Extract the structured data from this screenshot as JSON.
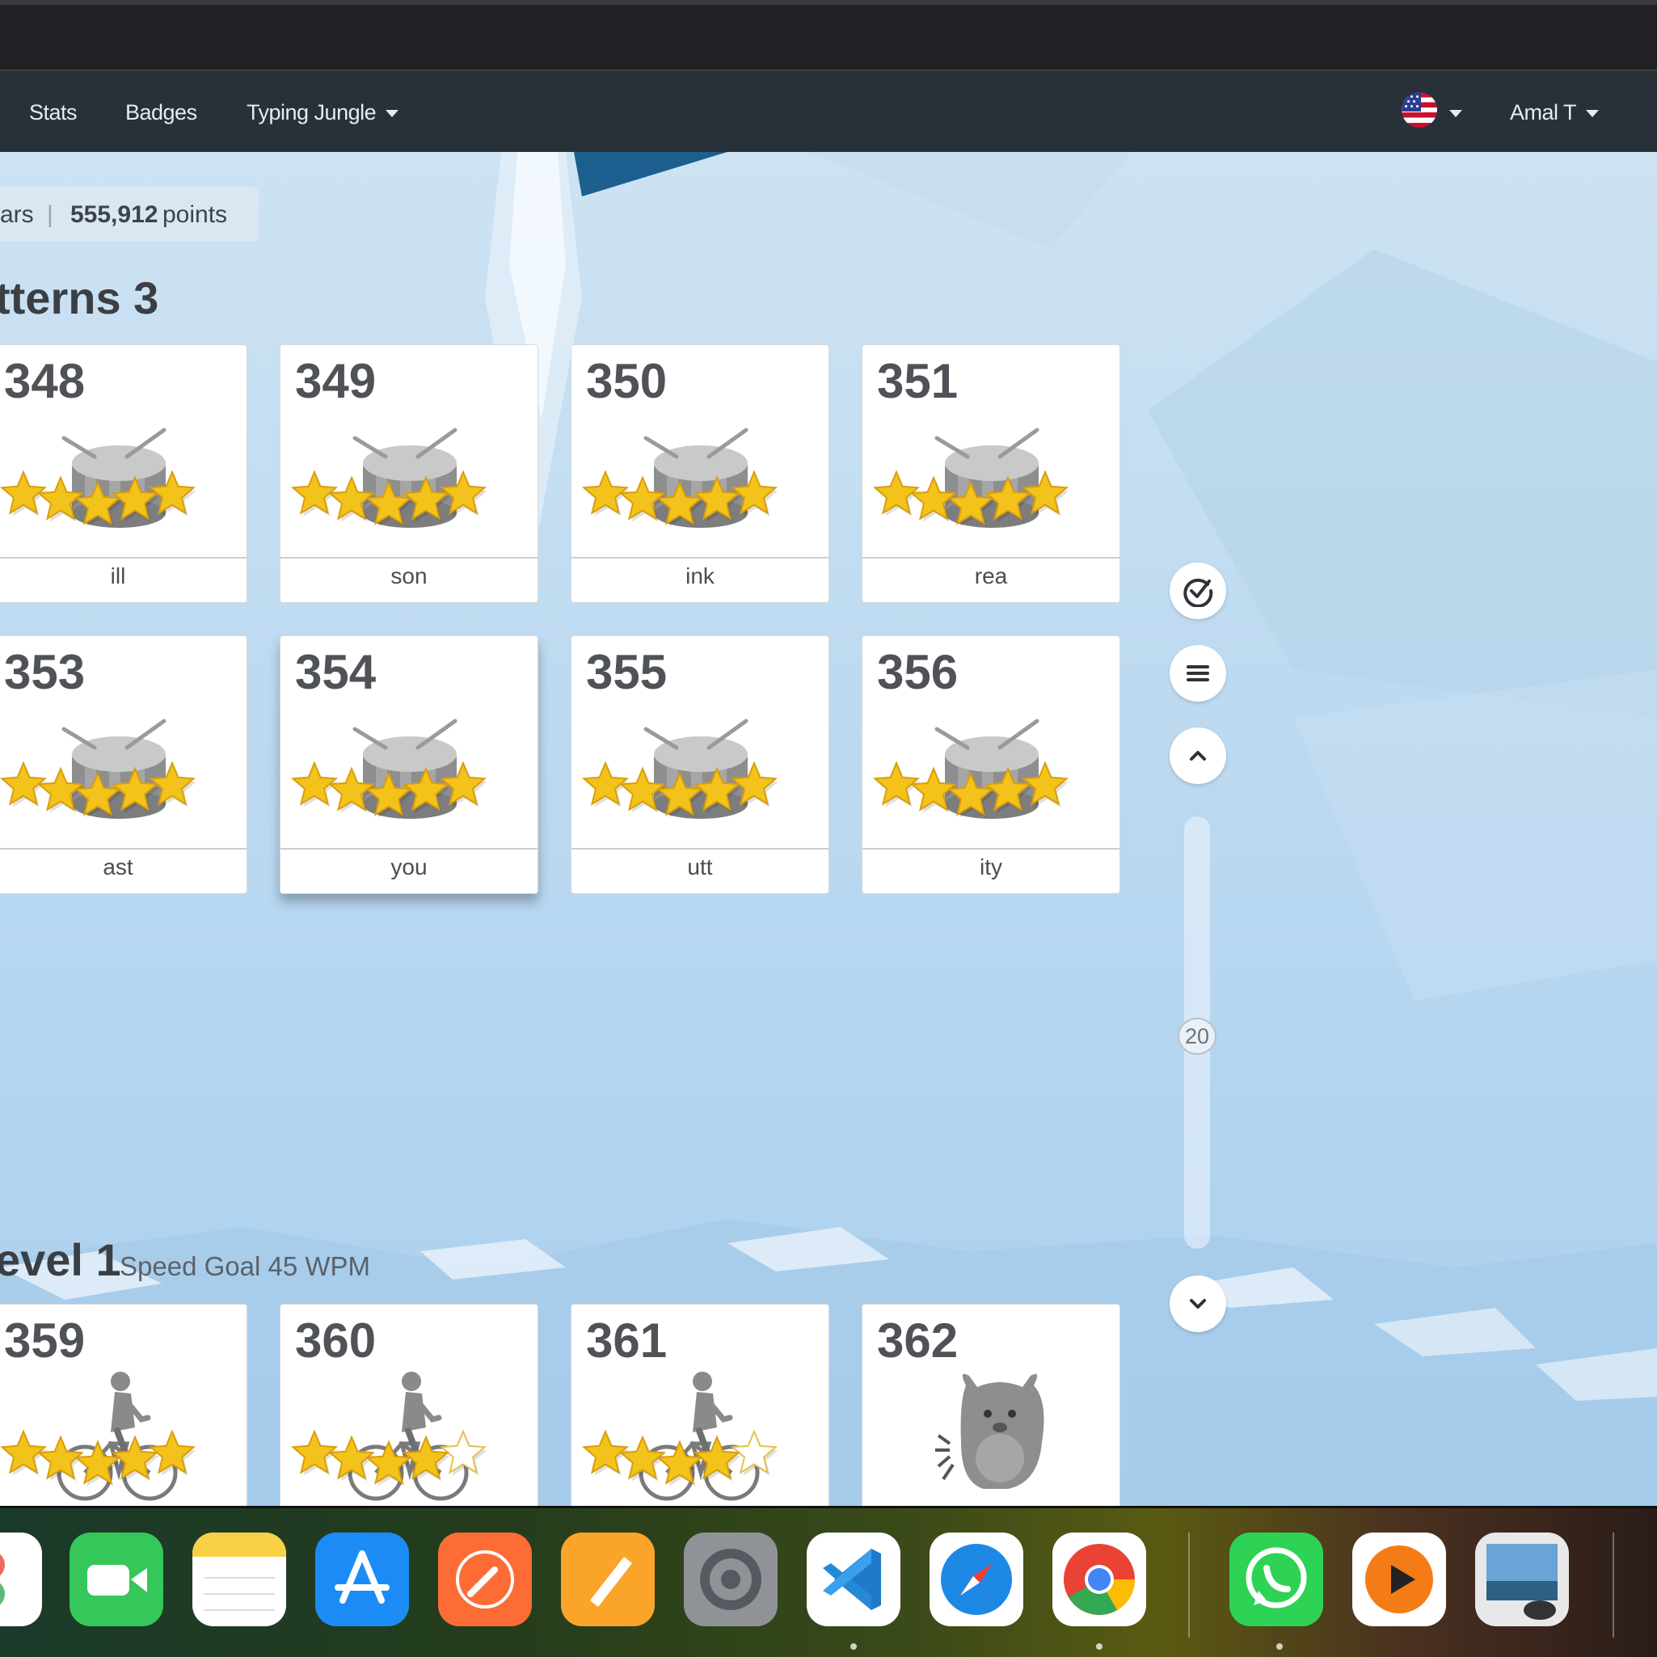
{
  "nav": {
    "items": [
      {
        "label": "Stats"
      },
      {
        "label": "Badges"
      },
      {
        "label": "Typing Jungle"
      }
    ],
    "user_name": "Amal T"
  },
  "stats": {
    "left_fragment": "ars",
    "separator": "|",
    "points_value": "555,912",
    "points_label": "points"
  },
  "sections": [
    {
      "title": "tterns 3",
      "speed_goal": ""
    },
    {
      "title": "evel 1",
      "speed_goal": "Speed Goal 45 WPM"
    }
  ],
  "lessons_row1": [
    {
      "number": "348",
      "label": "ill",
      "stars": 5,
      "icon": "drum-icon"
    },
    {
      "number": "349",
      "label": "son",
      "stars": 5,
      "icon": "drum-icon"
    },
    {
      "number": "350",
      "label": "ink",
      "stars": 5,
      "icon": "drum-icon"
    },
    {
      "number": "351",
      "label": "rea",
      "stars": 5,
      "icon": "drum-icon"
    }
  ],
  "lessons_row2": [
    {
      "number": "353",
      "label": "ast",
      "stars": 5,
      "icon": "drum-icon"
    },
    {
      "number": "354",
      "label": "you",
      "stars": 5,
      "icon": "drum-icon"
    },
    {
      "number": "355",
      "label": "utt",
      "stars": 5,
      "icon": "drum-icon"
    },
    {
      "number": "356",
      "label": "ity",
      "stars": 5,
      "icon": "drum-icon"
    }
  ],
  "lessons_row3": [
    {
      "number": "359",
      "stars": 5,
      "icon": "cyclist-icon"
    },
    {
      "number": "360",
      "stars": 4,
      "icon": "cyclist-icon"
    },
    {
      "number": "361",
      "stars": 4,
      "icon": "cyclist-icon"
    },
    {
      "number": "362",
      "stars": 0,
      "icon": "monster-icon"
    }
  ],
  "side_controls": {
    "scroll_indicator": "20"
  },
  "dock": {
    "apps": [
      "photos-icon",
      "facetime-icon",
      "notes-icon",
      "app-store-icon",
      "postman-icon",
      "pages-icon",
      "system-settings-icon",
      "vscode-icon",
      "safari-icon",
      "chrome-icon",
      "whatsapp-icon",
      "infuse-icon",
      "preview-icon"
    ]
  },
  "colors": {
    "navbar": "#283038",
    "star": "#f3c31c",
    "card_number": "#4f5257",
    "background": "#bcd9f0"
  }
}
